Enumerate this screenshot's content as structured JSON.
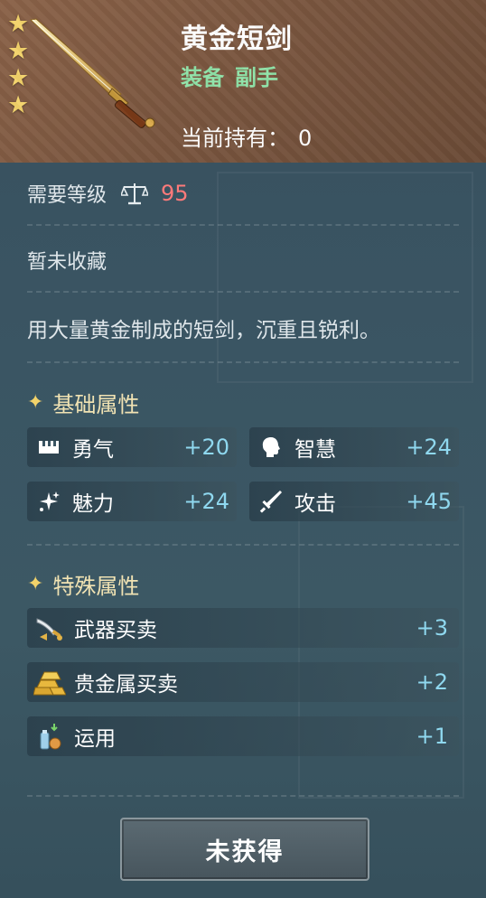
{
  "item": {
    "name": "黄金短剑",
    "type_primary": "装备",
    "type_secondary": "副手",
    "owned_label": "当前持有：",
    "owned_value": "0",
    "stars": 4
  },
  "requirement": {
    "label": "需要等级",
    "icon": "scale-icon",
    "level": "95"
  },
  "collection_status": "暂未收藏",
  "description": "用大量黄金制成的短剑，沉重且锐利。",
  "basic_section": {
    "title": "基础属性",
    "attributes": [
      {
        "name": "勇气",
        "value": "+20",
        "icon": "courage-icon"
      },
      {
        "name": "智慧",
        "value": "+24",
        "icon": "wisdom-icon"
      },
      {
        "name": "魅力",
        "value": "+24",
        "icon": "charm-icon"
      },
      {
        "name": "攻击",
        "value": "+45",
        "icon": "attack-icon"
      }
    ]
  },
  "special_section": {
    "title": "特殊属性",
    "attributes": [
      {
        "name": "武器买卖",
        "value": "+3",
        "icon": "weapon-trade-icon"
      },
      {
        "name": "贵金属买卖",
        "value": "+2",
        "icon": "precious-metal-trade-icon"
      },
      {
        "name": "运用",
        "value": "+1",
        "icon": "utilize-icon"
      }
    ]
  },
  "action_button": {
    "label": "未获得"
  },
  "colors": {
    "header_bg": "#7a563f",
    "panel_bg": "#3a5563",
    "level_red": "#ff7a7a",
    "type_green": "#8fe3a8",
    "value_blue": "#8fd8ef",
    "star_gold": "#f3d36a"
  }
}
